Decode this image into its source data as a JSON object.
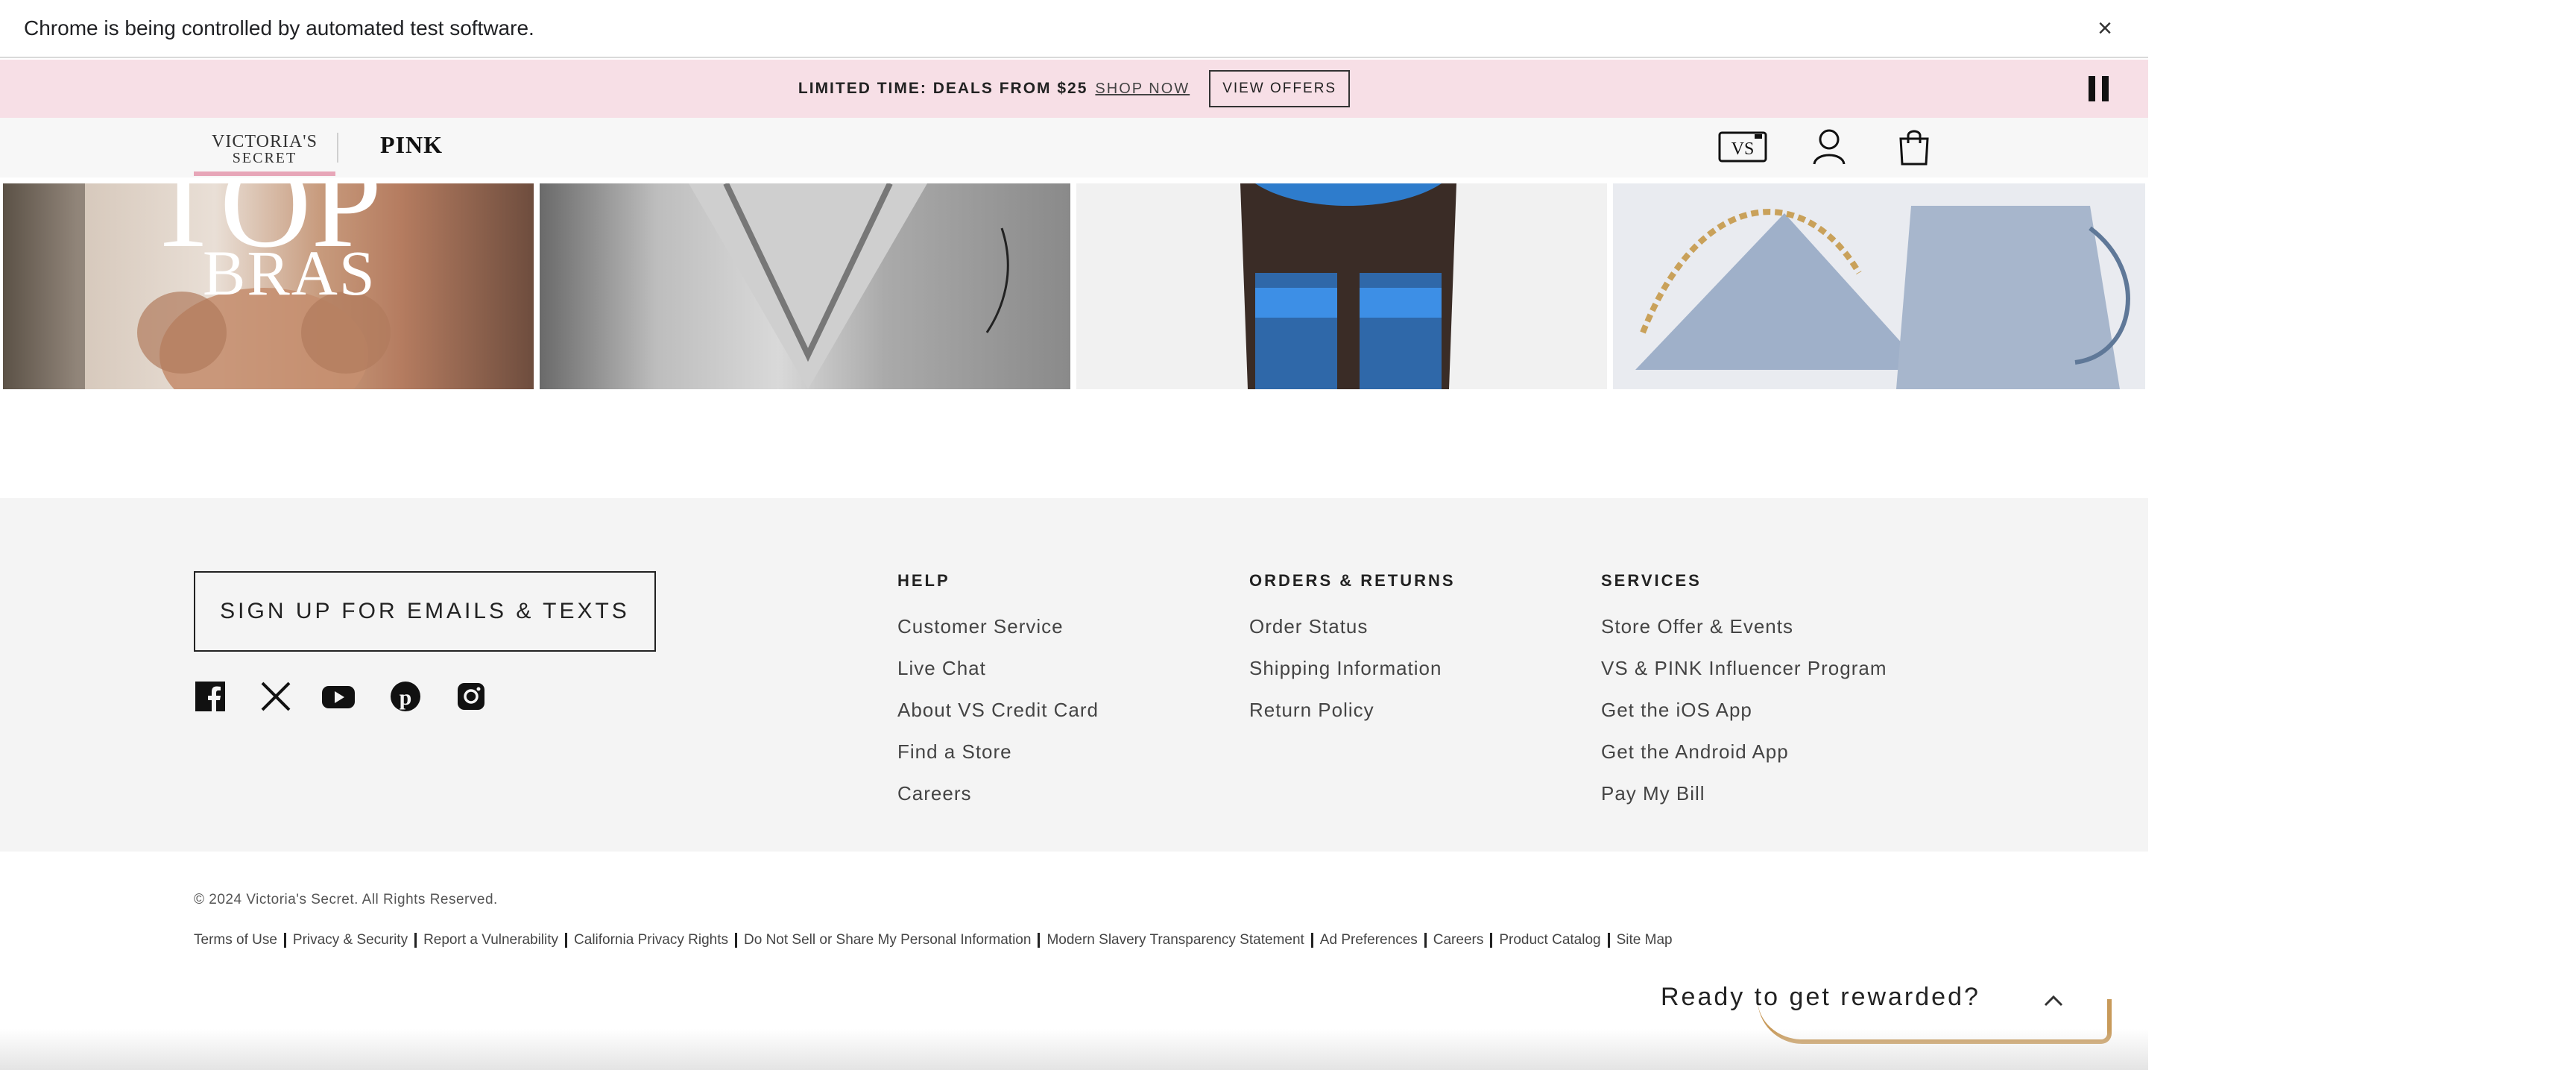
{
  "infobar": {
    "message": "Chrome is being controlled by automated test software.",
    "close_icon": "close-icon"
  },
  "promo": {
    "text": "LIMITED TIME: DEALS FROM $25",
    "link": "SHOP NOW",
    "button": "VIEW OFFERS",
    "pause_icon": "pause-icon"
  },
  "header": {
    "brand_vs_line1": "VICTORIA'S",
    "brand_vs_line2": "SECRET",
    "brand_pink": "PINK",
    "icons": [
      "vs-card-icon",
      "account-icon",
      "shopping-bag-icon"
    ]
  },
  "tiles": {
    "tile1_text": "BRAS"
  },
  "footer": {
    "signup": "SIGN UP FOR EMAILS & TEXTS",
    "social_icons": [
      "facebook-icon",
      "x-icon",
      "youtube-icon",
      "pinterest-icon",
      "instagram-icon"
    ],
    "columns": [
      {
        "title": "HELP",
        "links": [
          "Customer Service",
          "Live Chat",
          "About VS Credit Card",
          "Find a Store",
          "Careers"
        ]
      },
      {
        "title": "ORDERS & RETURNS",
        "links": [
          "Order Status",
          "Shipping Information",
          "Return Policy"
        ]
      },
      {
        "title": "SERVICES",
        "links": [
          "Store Offer & Events",
          "VS & PINK Influencer Program",
          "Get the iOS App",
          "Get the Android App",
          "Pay My Bill"
        ]
      }
    ]
  },
  "legal": {
    "copyright": "© 2024 Victoria's Secret. All Rights Reserved.",
    "links": [
      "Terms of Use",
      "Privacy & Security",
      "Report a Vulnerability",
      "California Privacy Rights",
      "Do Not Sell or Share My Personal Information",
      "Modern Slavery Transparency Statement",
      "Ad Preferences",
      "Careers",
      "Product Catalog",
      "Site Map"
    ]
  },
  "rewards": {
    "text": "Ready to get rewarded?",
    "chevron_icon": "chevron-up-icon"
  },
  "colors": {
    "promo_bg": "#f7dfe6",
    "footer_bg": "#f4f4f4",
    "rewards_accent": "#c89a5a",
    "brand_underline": "#e7a6b8"
  }
}
